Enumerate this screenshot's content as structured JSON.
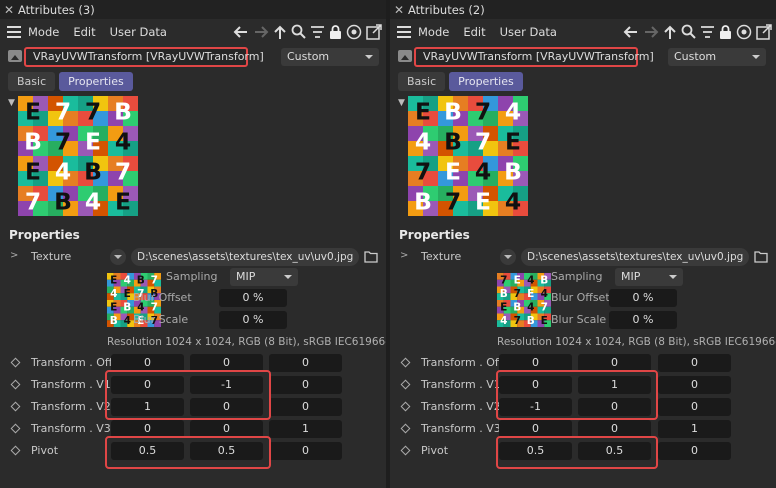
{
  "panels": [
    {
      "title": "Attributes (3)",
      "menu": [
        "Mode",
        "Edit",
        "User Data"
      ],
      "object_name": "VRayUVWTransform [VRayUVWTransform]",
      "mode_select": "Custom",
      "tabs": [
        "Basic",
        "Properties"
      ],
      "active_tab": "Properties",
      "section_title": "Properties",
      "texture": {
        "label": "Texture",
        "path": "D:\\scenes\\assets\\textures\\tex_uv\\uv0.jpg",
        "sampling_label": "Sampling",
        "sampling_value": "MIP",
        "blur_offset_label": "Blur Offset",
        "blur_offset_value": "0 %",
        "blur_scale_label": "Blur Scale",
        "blur_scale_value": "0 %",
        "resolution": "Resolution 1024 x 1024, RGB (8 Bit), sRGB IEC61966-2.1"
      },
      "rows": [
        {
          "label": "Transform . Off",
          "values": [
            "0",
            "0",
            "0"
          ]
        },
        {
          "label": "Transform . V1",
          "values": [
            "0",
            "-1",
            "0"
          ]
        },
        {
          "label": "Transform . V2",
          "values": [
            "1",
            "0",
            "0"
          ]
        },
        {
          "label": "Transform . V3",
          "values": [
            "0",
            "0",
            "1"
          ]
        },
        {
          "label": "Pivot",
          "values": [
            "0.5",
            "0.5",
            "0"
          ]
        }
      ]
    },
    {
      "title": "Attributes (2)",
      "menu": [
        "Mode",
        "Edit",
        "User Data"
      ],
      "object_name": "VRayUVWTransform [VRayUVWTransform]",
      "mode_select": "Custom",
      "tabs": [
        "Basic",
        "Properties"
      ],
      "active_tab": "Properties",
      "section_title": "Properties",
      "texture": {
        "label": "Texture",
        "path": "D:\\scenes\\assets\\textures\\tex_uv\\uv0.jpg",
        "sampling_label": "Sampling",
        "sampling_value": "MIP",
        "blur_offset_label": "Blur Offset",
        "blur_offset_value": "0 %",
        "blur_scale_label": "Blur Scale",
        "blur_scale_value": "0 %",
        "resolution": "Resolution 1024 x 1024, RGB (8 Bit), sRGB IEC61966-2.1"
      },
      "rows": [
        {
          "label": "Transform . Off",
          "values": [
            "0",
            "0",
            "0"
          ]
        },
        {
          "label": "Transform . V1",
          "values": [
            "0",
            "1",
            "0"
          ]
        },
        {
          "label": "Transform . V2",
          "values": [
            "-1",
            "0",
            "0"
          ]
        },
        {
          "label": "Transform . V3",
          "values": [
            "0",
            "0",
            "1"
          ]
        },
        {
          "label": "Pivot",
          "values": [
            "0.5",
            "0.5",
            "0"
          ]
        }
      ]
    }
  ],
  "icons": [
    "close-icon",
    "hamburger-menu-icon",
    "arrow-left-icon",
    "arrow-right-icon",
    "arrow-up-icon",
    "search-icon",
    "filter-icon",
    "lock-icon",
    "target-icon",
    "new-window-icon",
    "image-object-icon",
    "folder-icon",
    "chevron-down-icon",
    "keyframe-diamond-icon"
  ],
  "colors": {
    "highlight": "#e04646",
    "active_tab": "#5a5a9c",
    "panel_bg": "#2b2b2b",
    "field_bg": "#1a1a1a"
  },
  "preview_tiles": {
    "left": {
      "grid": [
        [
          "E",
          "7",
          "7",
          "B"
        ],
        [
          "B",
          "7",
          "E",
          "4"
        ],
        [
          "E",
          "4",
          "B",
          "7"
        ],
        [
          "7",
          "B",
          "4",
          "E"
        ]
      ],
      "cells": [
        "E",
        "4",
        "B",
        "7",
        "4",
        "E",
        "7",
        "B",
        "E",
        "B",
        "4",
        "7",
        "B",
        "4",
        "E",
        "7"
      ]
    },
    "right": {
      "grid": [
        [
          "E",
          "B",
          "7",
          "4"
        ],
        [
          "4",
          "B",
          "7",
          "E"
        ],
        [
          "7",
          "E",
          "4",
          "B"
        ],
        [
          "B",
          "7",
          "E",
          "4"
        ]
      ],
      "cells": [
        "7",
        "E",
        "4",
        "B",
        "B",
        "7",
        "E",
        "4",
        "E",
        "B",
        "4",
        "7",
        "4",
        "7",
        "B",
        "E"
      ]
    }
  }
}
